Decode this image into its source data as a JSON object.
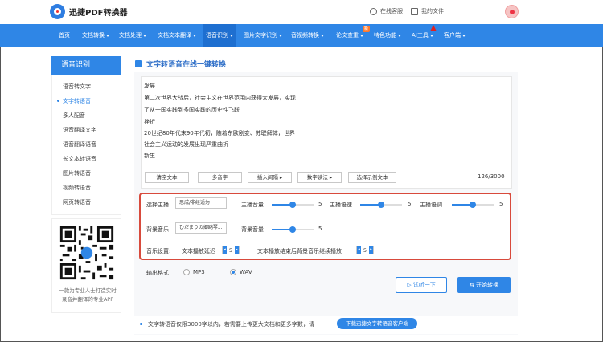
{
  "header": {
    "logo_text": "迅捷PDF转换器",
    "support_label": "在线客服",
    "my_files_label": "我的文件",
    "support_icon": "headset-icon",
    "files_icon": "document-icon"
  },
  "nav": {
    "items": [
      {
        "label": "首页"
      },
      {
        "label": "文档转换"
      },
      {
        "label": "文档处理"
      },
      {
        "label": "文档文本翻译"
      },
      {
        "label": "语音识别"
      },
      {
        "label": "图片文字识别"
      },
      {
        "label": "音视频转换"
      },
      {
        "label": "论文查重"
      },
      {
        "label": "特色功能"
      },
      {
        "label": "AI工具"
      },
      {
        "label": "客户端"
      }
    ],
    "new_badge": "新",
    "accent": "#2f86e6"
  },
  "sidebar": {
    "title": "语音识别",
    "items": [
      {
        "label": "语音转文字"
      },
      {
        "label": "文字转语音"
      },
      {
        "label": "多人配音"
      },
      {
        "label": "语音翻译文字"
      },
      {
        "label": "语音翻译语音"
      },
      {
        "label": "长文本转语音"
      },
      {
        "label": "图片转语音"
      },
      {
        "label": "视频转语音"
      },
      {
        "label": "网页转语音"
      }
    ],
    "qr_caption_line1": "一款为专业人士打造实时",
    "qr_caption_line2": "录音并翻译的专业APP"
  },
  "main": {
    "title": "文字转语音在线一键转换",
    "text_lines": [
      "发展",
      "第二次世界大战后，社会主义在世界范围内获得大发展，实现",
      "了从一国实践到多国实践的历史性飞跃",
      "挫折",
      "20世纪80年代末90年代初，随着东欧剧变、苏联解体，世界",
      "社会主义运动的发展出现严重曲折",
      "新生"
    ],
    "buttons": {
      "clear": "清空文本",
      "polyphone": "多音字",
      "insert_pause": "插入间隔",
      "number_read": "数字读法",
      "sample": "选择示例文本"
    },
    "counter": "126/3000",
    "settings": {
      "voice_label": "选择主播",
      "voice_value": "思成/非经适为",
      "volume_label": "主播音量",
      "volume_value": "5",
      "volume_level": 0.5,
      "speed_label": "主播语速",
      "speed_value": "5",
      "speed_level": 0.5,
      "pitch_label": "主播语调",
      "pitch_value": "5",
      "pitch_level": 0.5,
      "bgm_label": "背景音乐",
      "bgm_value": "ひだまりの郷鸥琴...",
      "bgm_volume_label": "背景音量",
      "bgm_volume_value": "5",
      "bgm_volume_level": 0.5,
      "music_settings_label": "音乐设置:",
      "delay_label": "文本播放延迟",
      "delay_value": "5",
      "after_label": "文本播放结束后背景音乐继续播放",
      "after_value": "5"
    },
    "output_format_label": "输出格式",
    "formats": [
      {
        "label": "MP3",
        "selected": false
      },
      {
        "label": "WAV",
        "selected": true
      }
    ],
    "try_label": "试听一下",
    "convert_label": "开始转换",
    "tip_text": "文字转语音仅限3000字以内，若需要上传更大文档和更多字数，请",
    "tip_button": "下载迅捷文字转语音客户端"
  }
}
